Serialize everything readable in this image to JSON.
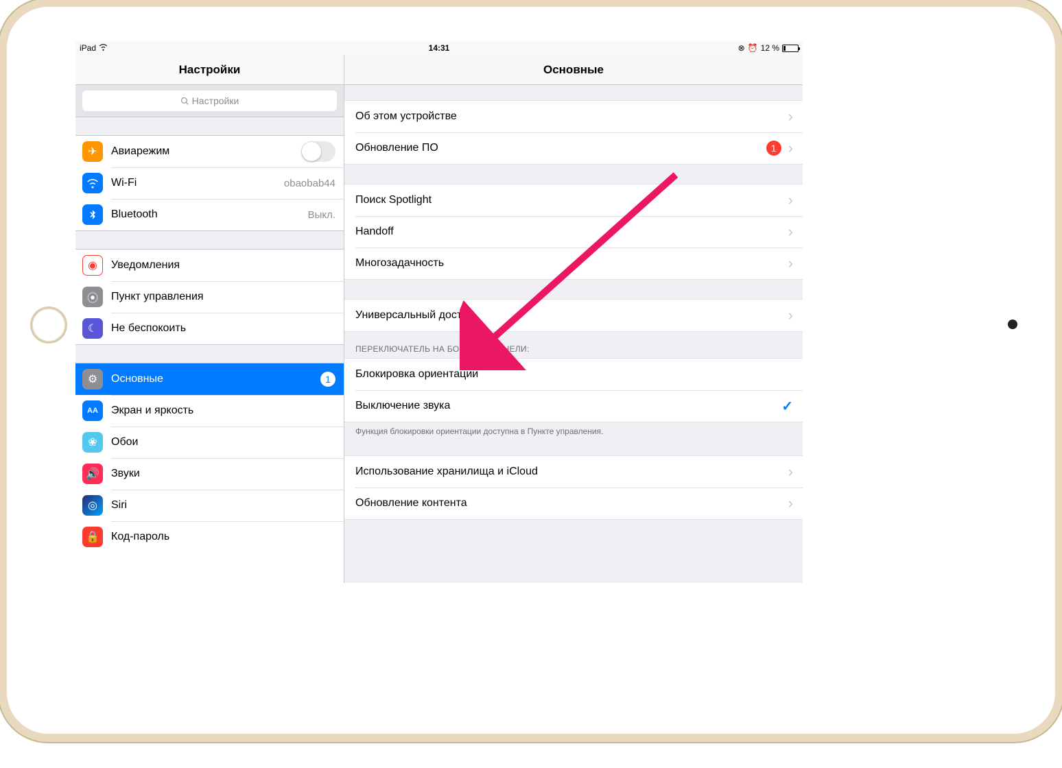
{
  "status": {
    "device": "iPad",
    "time": "14:31",
    "battery_text": "12 %"
  },
  "sidebar": {
    "title": "Настройки",
    "search_placeholder": "Настройки",
    "items": [
      {
        "label": "Авиарежим",
        "type": "toggle"
      },
      {
        "label": "Wi-Fi",
        "value": "obaobab44"
      },
      {
        "label": "Bluetooth",
        "value": "Выкл."
      }
    ],
    "items2": [
      {
        "label": "Уведомления"
      },
      {
        "label": "Пункт управления"
      },
      {
        "label": "Не беспокоить"
      }
    ],
    "items3": [
      {
        "label": "Основные",
        "badge": "1",
        "selected": true
      },
      {
        "label": "Экран и яркость"
      },
      {
        "label": "Обои"
      },
      {
        "label": "Звуки"
      },
      {
        "label": "Siri"
      },
      {
        "label": "Код-пароль"
      }
    ]
  },
  "detail": {
    "title": "Основные",
    "g1": [
      {
        "label": "Об этом устройстве"
      },
      {
        "label": "Обновление ПО",
        "badge": "1"
      }
    ],
    "g2": [
      {
        "label": "Поиск Spotlight"
      },
      {
        "label": "Handoff"
      },
      {
        "label": "Многозадачность"
      }
    ],
    "g3": [
      {
        "label": "Универсальный доступ"
      }
    ],
    "g4_header": "ПЕРЕКЛЮЧАТЕЛЬ НА БОКОВОЙ ПАНЕЛИ:",
    "g4": [
      {
        "label": "Блокировка ориентации"
      },
      {
        "label": "Выключение звука",
        "checked": true
      }
    ],
    "g4_footer": "Функция блокировки ориентации доступна в Пункте управления.",
    "g5": [
      {
        "label": "Использование хранилища и iCloud"
      },
      {
        "label": "Обновление контента"
      }
    ]
  }
}
